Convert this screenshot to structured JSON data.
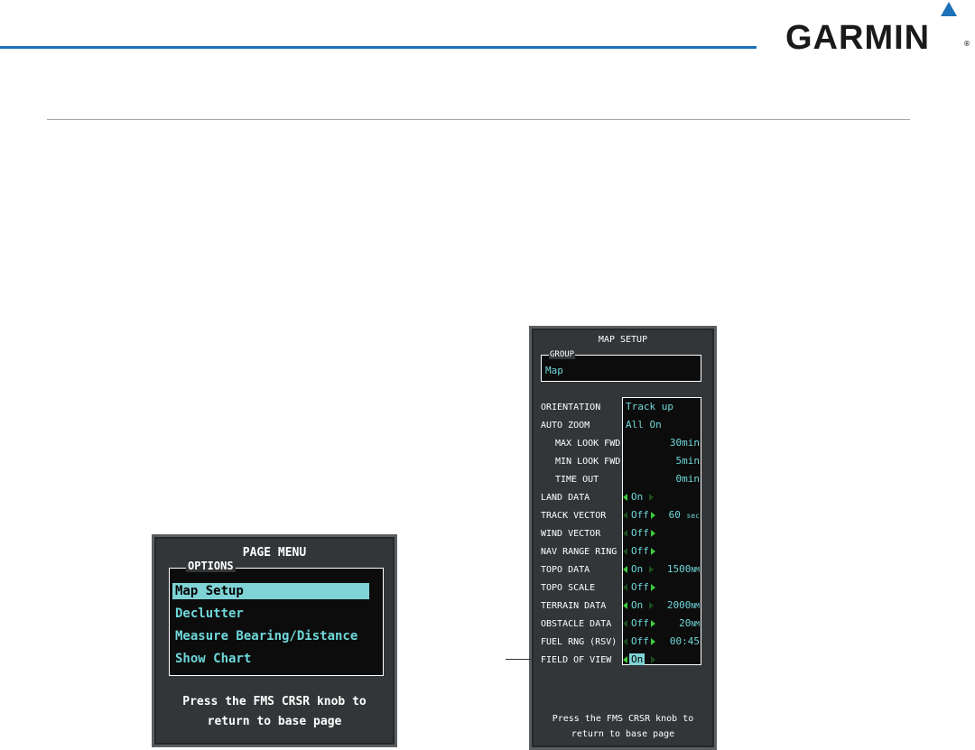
{
  "brand": {
    "name": "GARMIN",
    "reg": "®",
    "accent": "#1d72b8"
  },
  "page_menu": {
    "title": "PAGE MENU",
    "options_label": "OPTIONS",
    "items": [
      {
        "label": "Map Setup",
        "selected": true
      },
      {
        "label": "Declutter",
        "selected": false
      },
      {
        "label": "Measure Bearing/Distance",
        "selected": false
      },
      {
        "label": "Show Chart",
        "selected": false
      }
    ],
    "footer_line1": "Press the FMS CRSR knob to",
    "footer_line2": "return to base page"
  },
  "map_setup": {
    "title": "MAP SETUP",
    "group_label": "GROUP",
    "group_value": "Map",
    "rows": [
      {
        "label": "ORIENTATION",
        "value": "Track up"
      },
      {
        "label": "AUTO ZOOM",
        "value": "All On"
      },
      {
        "label": "MAX LOOK FWD",
        "value": "30min"
      },
      {
        "label": "MIN LOOK FWD",
        "value": "5min"
      },
      {
        "label": "TIME OUT",
        "value": "0min"
      },
      {
        "label": "LAND DATA",
        "value": "On"
      },
      {
        "label": "TRACK VECTOR",
        "value": "Off",
        "extra": "60",
        "extra_unit": "sec"
      },
      {
        "label": "WIND VECTOR",
        "value": "Off"
      },
      {
        "label": "NAV RANGE RING",
        "value": "Off"
      },
      {
        "label": "TOPO DATA",
        "value": "On",
        "extra": "1500",
        "extra_unit": "NM"
      },
      {
        "label": "TOPO SCALE",
        "value": "Off"
      },
      {
        "label": "TERRAIN DATA",
        "value": "On",
        "extra": "2000",
        "extra_unit": "NM"
      },
      {
        "label": "OBSTACLE DATA",
        "value": "Off",
        "extra": "20",
        "extra_unit": "NM"
      },
      {
        "label": "FUEL RNG (RSV)",
        "value": "Off",
        "extra": "00:45"
      },
      {
        "label": "FIELD OF VIEW",
        "value": "On"
      }
    ],
    "footer_line1": "Press the FMS CRSR knob to",
    "footer_line2": "return to base page"
  }
}
